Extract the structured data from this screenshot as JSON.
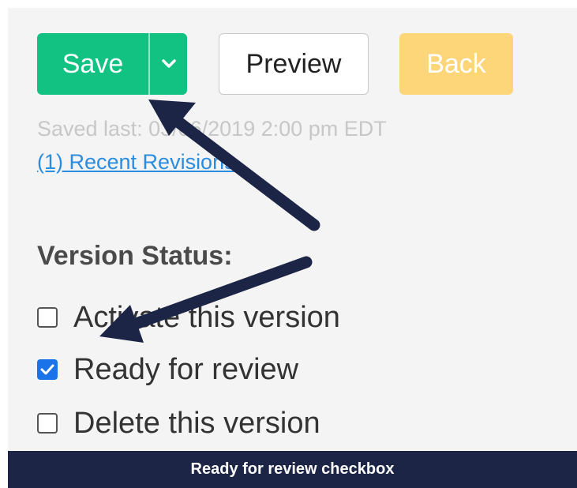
{
  "toolbar": {
    "save_label": "Save",
    "preview_label": "Preview",
    "back_label": "Back"
  },
  "status": {
    "saved_last": "Saved last: 03/06/2019 2:00 pm EDT",
    "revisions_link": "(1) Recent Revisions"
  },
  "version_status": {
    "title": "Version Status:",
    "options": [
      {
        "label": "Activate this version",
        "checked": false
      },
      {
        "label": "Ready for review",
        "checked": true
      },
      {
        "label": "Delete this version",
        "checked": false
      }
    ]
  },
  "caption": {
    "text": "Ready for review checkbox"
  },
  "colors": {
    "save": "#12c283",
    "back": "#fdd67a",
    "checkbox_checked": "#1a73e8",
    "link": "#2b8de0",
    "arrow": "#1c2545",
    "caption_bg": "#1c2545"
  },
  "icons": {
    "save_dropdown": "chevron-down-icon",
    "checked": "checkmark-icon",
    "annotation": "arrow-icon"
  }
}
